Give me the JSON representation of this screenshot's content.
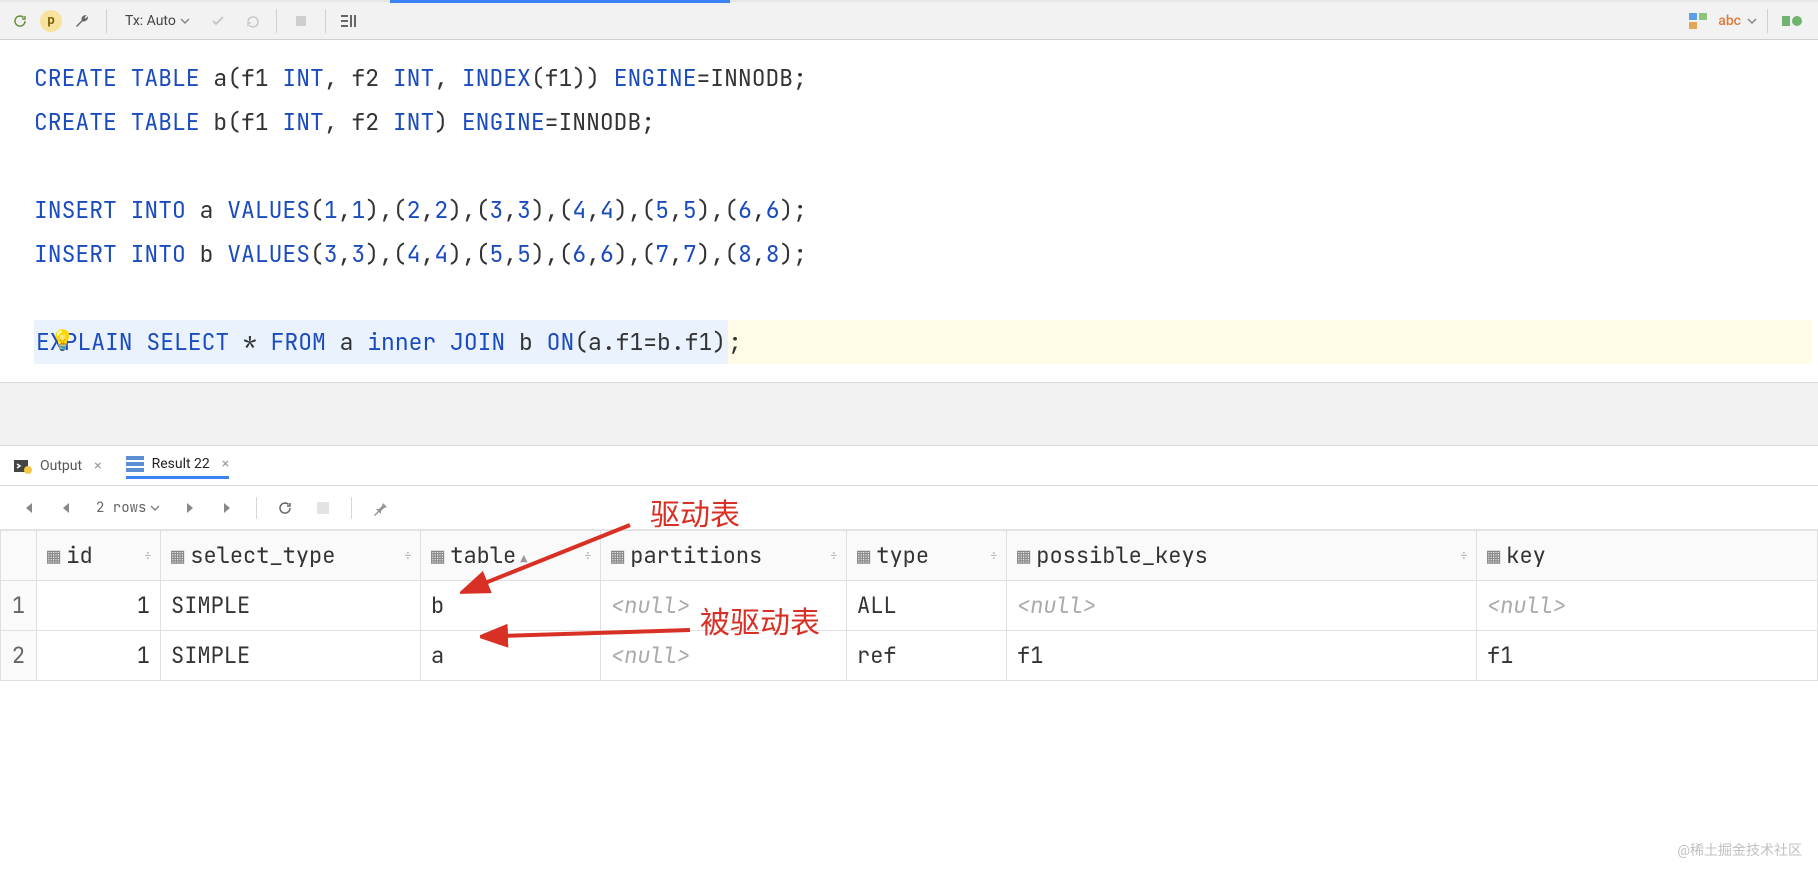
{
  "toolbar": {
    "badge_letter": "p",
    "tx_label": "Tx: Auto",
    "right_label": "abc"
  },
  "sql": {
    "create_a_prefix": "CREATE TABLE",
    "create_a_name": "a",
    "create_a_cols": "(f1 INT, f2 INT, INDEX(f1))",
    "create_a_engine": "ENGINE=INNODB;",
    "create_b_prefix": "CREATE TABLE",
    "create_b_name": "b",
    "create_b_cols": "(f1 INT, f2 INT)",
    "create_b_engine": "ENGINE=INNODB;",
    "insert_a": "INSERT INTO a VALUES(1,1),(2,2),(3,3),(4,4),(5,5),(6,6);",
    "insert_b": "INSERT INTO b VALUES(3,3),(4,4),(5,5),(6,6),(7,7),(8,8);",
    "explain": "EXPLAIN SELECT * FROM a inner JOIN b ON(a.f1=b.f1);"
  },
  "tabs": {
    "output": "Output",
    "result": "Result 22"
  },
  "results_toolbar": {
    "rows": "2 rows"
  },
  "columns": [
    "id",
    "select_type",
    "table",
    "partitions",
    "type",
    "possible_keys",
    "key"
  ],
  "rows": [
    {
      "n": "1",
      "id": "1",
      "select_type": "SIMPLE",
      "table": "b",
      "partitions": "<null>",
      "type": "ALL",
      "possible_keys": "<null>",
      "key": "<null>"
    },
    {
      "n": "2",
      "id": "1",
      "select_type": "SIMPLE",
      "table": "a",
      "partitions": "<null>",
      "type": "ref",
      "possible_keys": "f1",
      "key": "f1"
    }
  ],
  "annotations": {
    "driving": "驱动表",
    "driven": "被驱动表"
  },
  "watermark": "@稀土掘金技术社区"
}
